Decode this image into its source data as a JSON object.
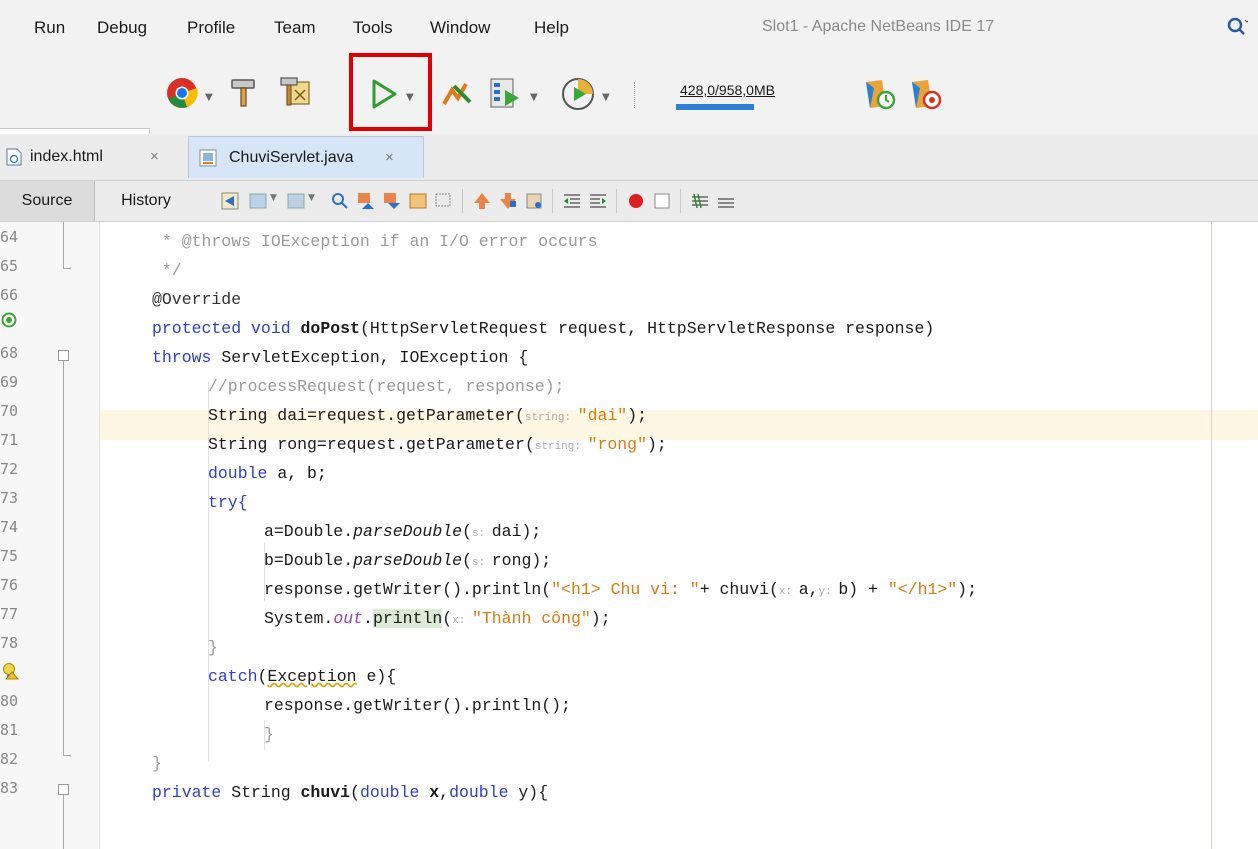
{
  "menu": {
    "items": [
      "Run",
      "Debug",
      "Profile",
      "Team",
      "Tools",
      "Window",
      "Help"
    ],
    "window_title": "Slot1 - Apache NetBeans IDE 17"
  },
  "toolbar": {
    "memory": "428,0/958,0MB",
    "memory_fraction": 0.45,
    "highlight_color": "#e00000",
    "icons": [
      "browser-chrome-icon",
      "build-hammer-icon",
      "clean-build-icon",
      "run-project-icon",
      "debug-project-icon",
      "profile-project-icon",
      "run-file-icon",
      "gc-icon-1",
      "gc-icon-2"
    ]
  },
  "tabs": [
    {
      "label": "index.html",
      "close": "×"
    },
    {
      "label": "ChuviServlet.java",
      "close": "×"
    }
  ],
  "editor": {
    "source": "Source",
    "history": "History"
  },
  "gutter": {
    "numbers": [
      "64",
      "65",
      "66",
      "",
      "68",
      "69",
      "70",
      "71",
      "72",
      "73",
      "74",
      "75",
      "76",
      "77",
      "78",
      "",
      "80",
      "81",
      "82",
      "83"
    ]
  },
  "code": {
    "l64": " * @throws IOException if an I/O error occurs",
    "l65": " */",
    "l66": "@Override",
    "l67_kw": "protected void ",
    "l67_fn": "doPost",
    "l67_rest": "(HttpServletRequest request, HttpServletResponse response)",
    "l68_kw": "throws ",
    "l68_rest": "ServletException, IOException {",
    "l69": "//processRequest(request, response);",
    "l70_a": "String dai=request.getParameter(",
    "l70_hint": "string: ",
    "l70_str": "\"dai\"",
    "l70_end": ");",
    "l71_a": "String rong=request.getParameter(",
    "l71_hint": "string: ",
    "l71_str": "\"rong\"",
    "l71_end": ");",
    "l72_kw": "double ",
    "l72_rest": "a, b;",
    "l73": "try{",
    "l74_a": "a=Double.",
    "l74_it": "parseDouble",
    "l74_p": "(",
    "l74_hint": "s: ",
    "l74_end": "dai);",
    "l75_a": "b=Double.",
    "l75_it": "parseDouble",
    "l75_p": "(",
    "l75_hint": "s: ",
    "l75_end": "rong);",
    "l76_a": "response.getWriter().println(",
    "l76_s1": "\"<h1> Chu vi: \"",
    "l76_b": "+ chuvi(",
    "l76_h1": "x: ",
    "l76_c": "a,",
    "l76_h2": "y: ",
    "l76_d": "b) + ",
    "l76_s2": "\"</h1>\"",
    "l76_e": ");",
    "l77_a": "System.",
    "l77_fld": "out",
    "l77_dot": ".",
    "l77_m": "println",
    "l77_p": "(",
    "l77_hint": "x: ",
    "l77_str": "\"Thành công\"",
    "l77_end": ");",
    "l78": "}",
    "l79_kw": "catch",
    "l79_a": "(",
    "l79_ex": "Exception",
    "l79_b": " e){",
    "l80": "response.getWriter().println();",
    "l81": "}",
    "l82": "}",
    "l83_kw": "private ",
    "l83_a": "String ",
    "l83_fn": "chuvi",
    "l83_p": "(",
    "l83_kw2": "double ",
    "l83_x": "x",
    "l83_c": ",",
    "l83_kw3": "double ",
    "l83_y": "y){"
  }
}
